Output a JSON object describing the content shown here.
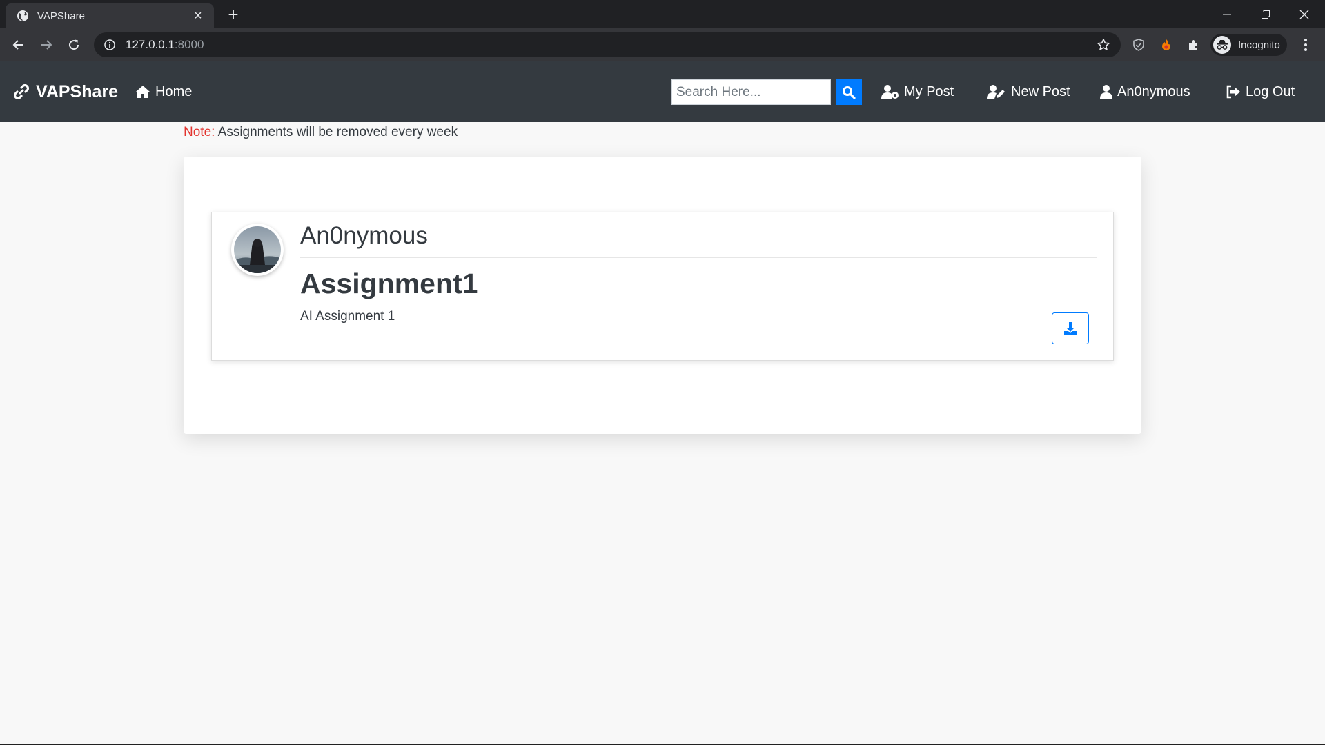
{
  "browser": {
    "tab_title": "VAPShare",
    "url_host": "127.0.0.1",
    "url_port": ":8000",
    "profile_label": "Incognito"
  },
  "navbar": {
    "brand": "VAPShare",
    "home": "Home",
    "search_placeholder": "Search Here...",
    "my_post": "My Post",
    "new_post": "New Post",
    "user": "An0nymous",
    "logout": "Log Out"
  },
  "note": {
    "label": "Note:",
    "text": " Assignments will be removed every week"
  },
  "post": {
    "author": "An0nymous",
    "title": "Assignment1",
    "description": "AI Assignment 1"
  },
  "colors": {
    "navbar_bg": "#343a40",
    "primary": "#007bff",
    "note_red": "#e3342f"
  }
}
